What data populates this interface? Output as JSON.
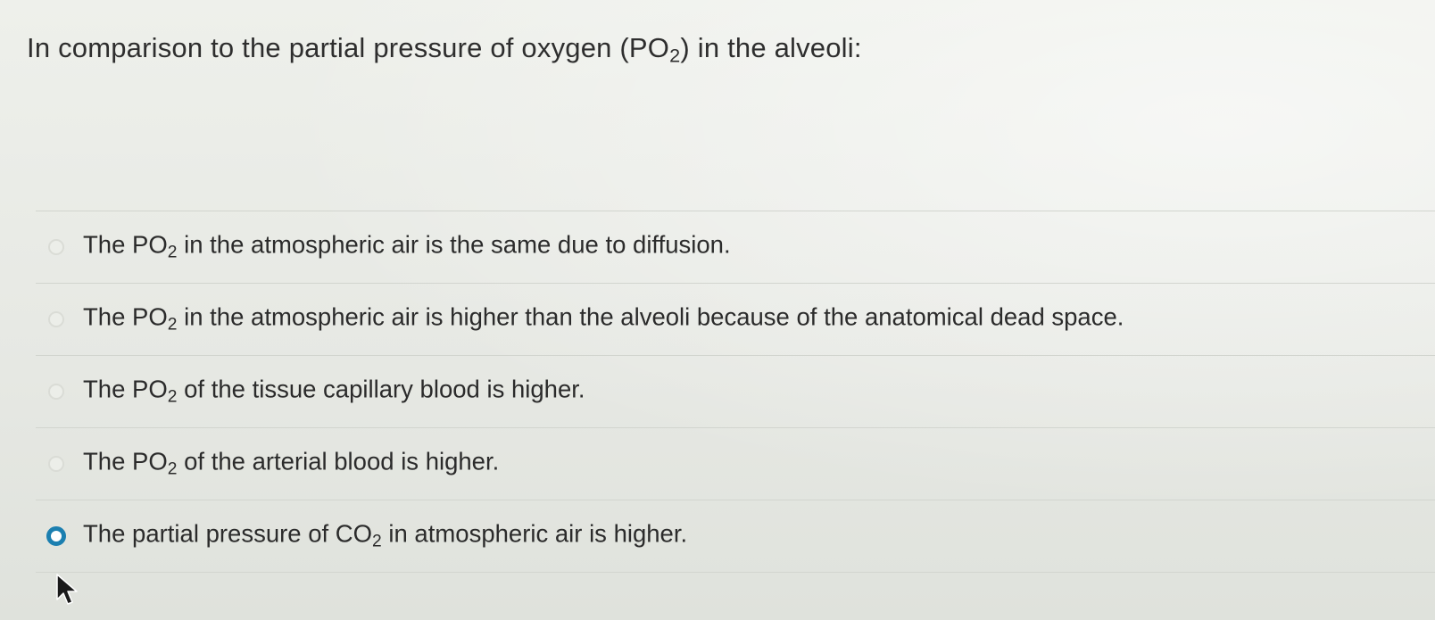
{
  "question": {
    "prefix": "In comparison to the partial pressure of oxygen (PO",
    "sub": "2",
    "suffix": ") in the alveoli:"
  },
  "options": [
    {
      "pre": "The PO",
      "sub": "2",
      "post": " in the atmospheric air is the same due to diffusion.",
      "selected": false
    },
    {
      "pre": "The PO",
      "sub": "2",
      "post": " in the atmospheric air is higher than the alveoli because of the anatomical dead space.",
      "selected": false
    },
    {
      "pre": "The PO",
      "sub": "2",
      "post": " of the tissue capillary blood is higher.",
      "selected": false
    },
    {
      "pre": "The PO",
      "sub": "2",
      "post": " of the arterial blood is higher.",
      "selected": false
    },
    {
      "pre": "The partial pressure of CO",
      "sub": "2",
      "post": " in atmospheric air is higher.",
      "selected": true
    }
  ],
  "colors": {
    "accent": "#1b7fb0",
    "text": "#2b2b2b",
    "background": "#e9ebe6"
  },
  "icons": {
    "cursor": "mouse-pointer-icon",
    "radio": "radio-button-icon"
  }
}
